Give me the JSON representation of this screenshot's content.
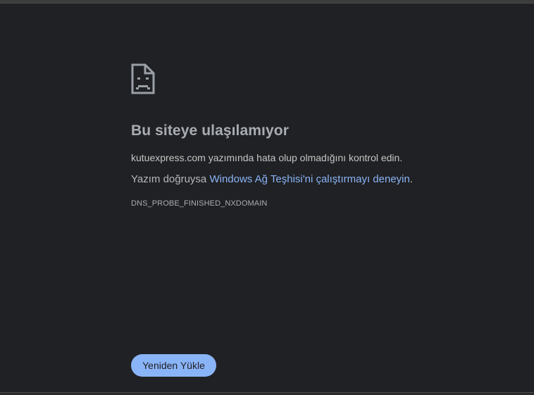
{
  "error": {
    "icon": "sad-page-icon",
    "title": "Bu siteye ulaşılamıyor",
    "message": "kutuexpress.com yazımında hata olup olmadığını kontrol edin.",
    "suggestion_prefix": "Yazım doğruysa ",
    "suggestion_link": "Windows Ağ Teşhisi'ni çalıştırmayı deneyin",
    "suggestion_suffix": ".",
    "code": "DNS_PROBE_FINISHED_NXDOMAIN"
  },
  "actions": {
    "reload_label": "Yeniden Yükle"
  },
  "colors": {
    "background": "#202124",
    "accent": "#8ab4f8",
    "title": "#a9adb3"
  }
}
